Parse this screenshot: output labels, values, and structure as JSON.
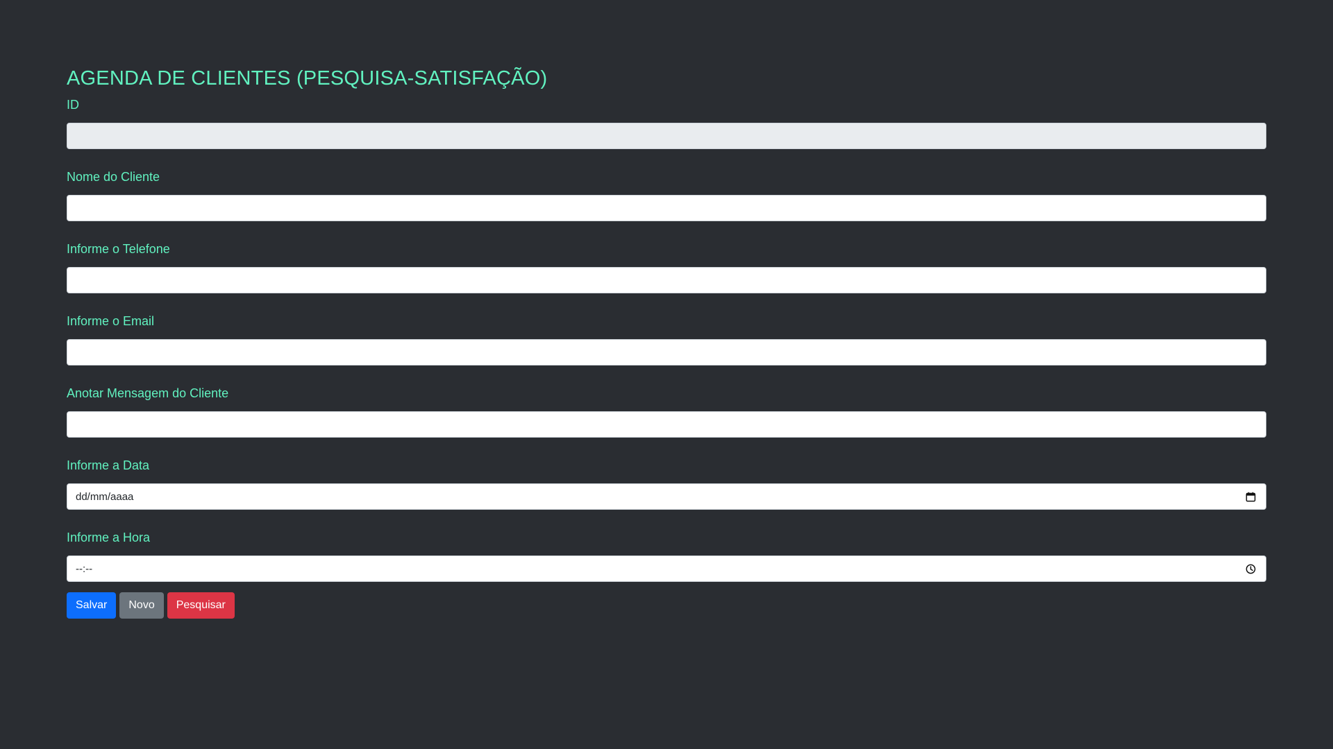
{
  "page": {
    "title": "AGENDA DE CLIENTES (PESQUISA-SATISFAÇÃO)"
  },
  "form": {
    "fields": [
      {
        "label": "ID",
        "value": "",
        "type": "text",
        "readonly": true
      },
      {
        "label": "Nome do Cliente",
        "value": "",
        "type": "text"
      },
      {
        "label": "Informe o Telefone",
        "value": "",
        "type": "text"
      },
      {
        "label": "Informe o Email",
        "value": "",
        "type": "text"
      },
      {
        "label": "Anotar Mensagem do Cliente",
        "value": "",
        "type": "text"
      },
      {
        "label": "Informe a Data",
        "value": "dd/mm/aaaa",
        "type": "date",
        "icon": "calendar-icon"
      },
      {
        "label": "Informe a Hora",
        "value": "--:--",
        "type": "time",
        "icon": "clock-icon"
      }
    ]
  },
  "buttons": {
    "save_label": "Salvar",
    "new_label": "Novo",
    "search_label": "Pesquisar"
  },
  "colors": {
    "background": "#2a2d32",
    "accent_text": "#61f2c0",
    "primary": "#0d6efd",
    "secondary": "#6c757d",
    "danger": "#dc3545"
  }
}
